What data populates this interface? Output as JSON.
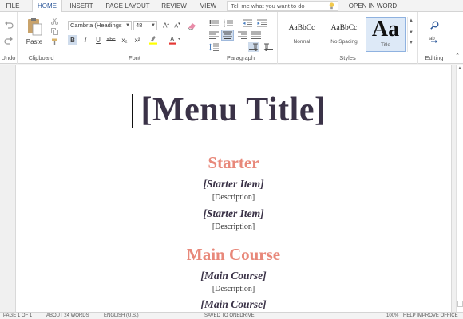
{
  "tabs": {
    "file": "FILE",
    "home": "HOME",
    "insert": "INSERT",
    "page_layout": "PAGE LAYOUT",
    "review": "REVIEW",
    "view": "VIEW",
    "tell_me_placeholder": "Tell me what you want to do",
    "open_in_word": "OPEN IN WORD"
  },
  "ribbon": {
    "undo_label": "Undo",
    "clipboard": {
      "paste": "Paste",
      "label": "Clipboard"
    },
    "font": {
      "name": "Cambria (Headings",
      "size": "48",
      "bold": "B",
      "italic": "I",
      "underline": "U",
      "strike": "abc",
      "subscript": "x₂",
      "superscript": "x²",
      "label": "Font"
    },
    "paragraph": {
      "label": "Paragraph"
    },
    "styles": {
      "label": "Styles",
      "items": [
        {
          "sample": "AaBbCc",
          "name": "Normal"
        },
        {
          "sample": "AaBbCc",
          "name": "No Spacing"
        },
        {
          "sample": "Aa",
          "name": "Title"
        }
      ]
    },
    "editing": {
      "label": "Editing"
    }
  },
  "document": {
    "title": "[Menu Title]",
    "sections": [
      {
        "heading": "Starter",
        "items": [
          {
            "name": "[Starter Item]",
            "desc": "[Description]"
          },
          {
            "name": "[Starter Item]",
            "desc": "[Description]"
          }
        ]
      },
      {
        "heading": "Main Course",
        "items": [
          {
            "name": "[Main Course]",
            "desc": "[Description]"
          },
          {
            "name": "[Main Course]",
            "desc": ""
          }
        ]
      }
    ]
  },
  "status": {
    "page": "PAGE 1 OF 1",
    "words": "ABOUT 24 WORDS",
    "language": "ENGLISH (U.S.)",
    "saved": "SAVED TO ONEDRIVE",
    "zoom": "100%",
    "help": "HELP IMPROVE OFFICE"
  },
  "colors": {
    "accent": "#2b579a",
    "title_text": "#3a3247",
    "section_heading": "#e8887a"
  }
}
